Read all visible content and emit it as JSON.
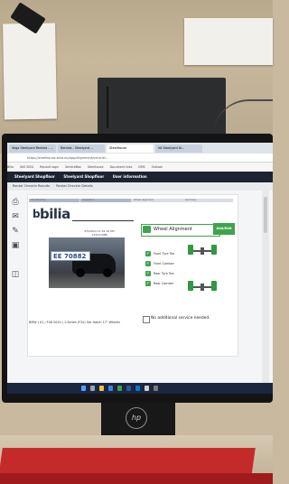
{
  "browser": {
    "tabs": [
      {
        "label": "Vega Steelyard Rentals - ...",
        "active": false
      },
      {
        "label": "Rentals - Steelyard ...",
        "active": false
      },
      {
        "label": "SteelHouse",
        "active": true
      },
      {
        "label": "VA Steelyard Al...",
        "active": false
      }
    ],
    "url": "https://steelhouse.bilia.no/app/alignment/vehicle/...",
    "bookmarks": [
      "Bilia",
      "VAS 5054",
      "Renault login",
      "ServiceBox",
      "Steelhouse",
      "Document links",
      "DMS",
      "Outlook"
    ]
  },
  "app": {
    "nav": [
      "Steelyard Shopfloor",
      "Steelyard Shopfloor",
      "User information"
    ],
    "subnav": [
      "Rental Checkin Results",
      "Rental Checkin Details"
    ],
    "steps": [
      "Identification",
      "Inspection",
      "Wheel alignment",
      "Summary"
    ],
    "brand": "bilia",
    "brand_mark": "b",
    "meta_date": "2/5/2024 11:32:16 PM",
    "meta_id": "123237988",
    "plate": "EE 70882",
    "service": {
      "label": "Wheel Alignment",
      "button": "Add/Edit"
    },
    "checks": [
      {
        "label": "Front Tyre Toe"
      },
      {
        "label": "Front Camber"
      },
      {
        "label": "Rear Tyre Toe"
      },
      {
        "label": "Rear Camber"
      }
    ],
    "no_service_label": "No additional service needed.",
    "vin_text": "BMW | X1 / F48 2020 | 1-Series (F20) 5dr Hatch 17\" Wheels"
  },
  "monitor": {
    "logo": "hp"
  },
  "colors": {
    "accent": "#3fa34d",
    "nav": "#1d2330",
    "taskbar": "#1b2640"
  }
}
